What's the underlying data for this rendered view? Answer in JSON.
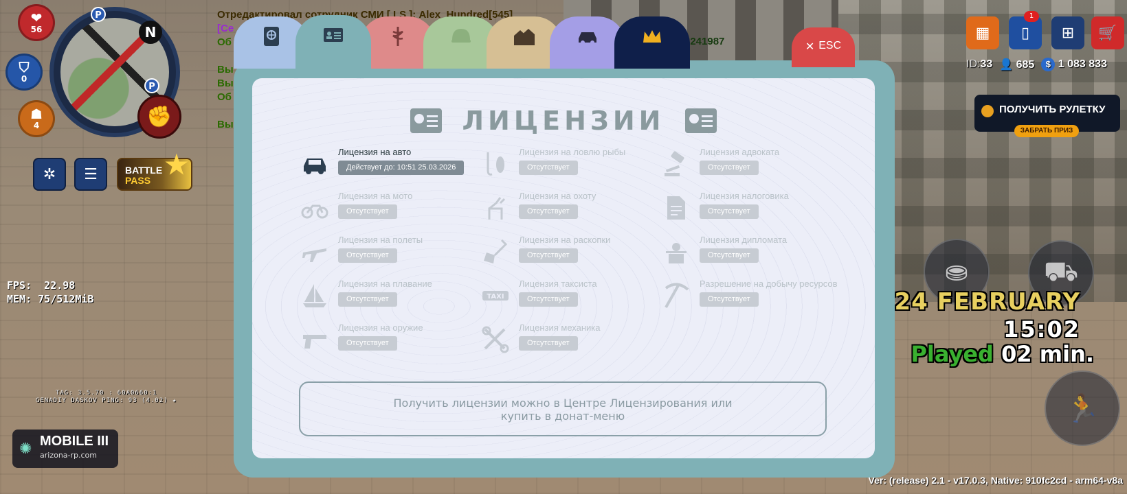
{
  "hud": {
    "health": "56",
    "armor": "0",
    "food": "4",
    "compass": "N",
    "map_marker": "P",
    "fps_line": "FPS:  22.98",
    "mem_line": "MEM: 75/512MiB",
    "tag_line": "TAG: 3.5.70 : 60A0660:1",
    "player_line": "GENADIY DASKOV  PING: 93 (4.02) ★",
    "server_name": "MOBILE III",
    "server_site": "arizona-rp.com",
    "battle_pass": {
      "line1": "BATTLE",
      "line2": "PASS"
    }
  },
  "chat": {
    "line1": "Отредактировал сотрудник СМИ [ LS ]: Alex_Hundred[545]",
    "line2": "[Се",
    "line3": "Об",
    "line4": "Вы",
    "line5": "Вы",
    "line6": "Об",
    "line7": "Вы",
    "phone_fragment": "3241987"
  },
  "top_right": {
    "phone_badge": "1",
    "id_label": "ID:",
    "id_value": "33",
    "online": "685",
    "money_symbol": "$",
    "money": "1 083 833",
    "roulette_label": "ПОЛУЧИТЬ РУЛЕТКУ",
    "roulette_claim": "ЗАБРАТЬ ПРИЗ"
  },
  "overlay": {
    "date": "24 FEBRUARY",
    "time": "15:02",
    "played_word": "Played",
    "played_value": "02 min.",
    "version": "Ver: (release) 2.1 - v17.0.3, Native: 910fc2cd - arm64-v8a"
  },
  "dialog": {
    "esc_label": "ESC",
    "title": "ЛИЦЕНЗИИ",
    "licenses": [
      {
        "name": "Лицензия на авто",
        "status": "Действует до: 10:51 25.03.2026",
        "icon": "car-icon",
        "active": true
      },
      {
        "name": "Лицензия на ловлю рыбы",
        "status": "Отсутствует",
        "icon": "fishing-icon",
        "active": false
      },
      {
        "name": "Лицензия адвоката",
        "status": "Отсутствует",
        "icon": "gavel-icon",
        "active": false
      },
      {
        "name": "Лицензия на мото",
        "status": "Отсутствует",
        "icon": "motorcycle-icon",
        "active": false
      },
      {
        "name": "Лицензия на охоту",
        "status": "Отсутствует",
        "icon": "deer-icon",
        "active": false
      },
      {
        "name": "Лицензия налоговика",
        "status": "Отсутствует",
        "icon": "document-icon",
        "active": false
      },
      {
        "name": "Лицензия на полеты",
        "status": "Отсутствует",
        "icon": "plane-icon",
        "active": false
      },
      {
        "name": "Лицензия на раскопки",
        "status": "Отсутствует",
        "icon": "shovel-icon",
        "active": false
      },
      {
        "name": "Лицензия дипломата",
        "status": "Отсутствует",
        "icon": "diplomat-icon",
        "active": false
      },
      {
        "name": "Лицензия на плавание",
        "status": "Отсутствует",
        "icon": "sailboat-icon",
        "active": false
      },
      {
        "name": "Лицензия таксиста",
        "status": "Отсутствует",
        "icon": "taxi-icon",
        "active": false
      },
      {
        "name": "Разрешение на добычу ресурсов",
        "status": "Отсутствует",
        "icon": "pickaxe-icon",
        "active": false
      },
      {
        "name": "Лицензия на оружие",
        "status": "Отсутствует",
        "icon": "gun-icon",
        "active": false
      },
      {
        "name": "Лицензия механика",
        "status": "Отсутствует",
        "icon": "tools-icon",
        "active": false
      }
    ],
    "info_line1": "Получить лицензии можно в Центре Лицензирования или",
    "info_line2": "купить в донат-меню"
  },
  "colors": {
    "dialog_frame": "#7fb1b6",
    "panel_bg": "#eceef8",
    "active_text": "#2a3a3e",
    "inactive_text": "#b9c2c8"
  }
}
